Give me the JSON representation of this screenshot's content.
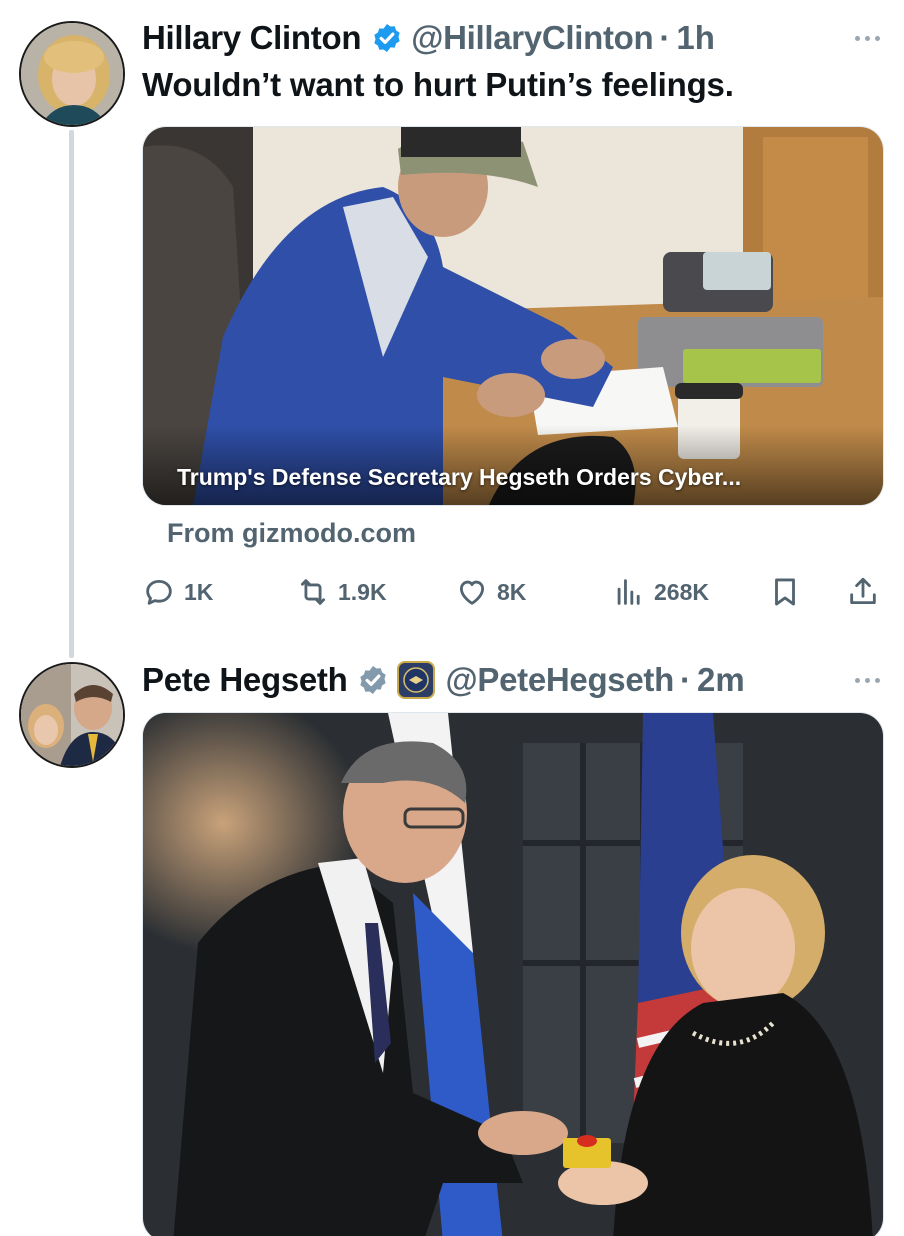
{
  "tweet1": {
    "author_name": "Hillary Clinton",
    "handle": "@HillaryClinton",
    "separator": "·",
    "time": "1h",
    "text": "Wouldn’t want to hurt Putin’s feelings.",
    "link_card": {
      "title": "Trump's Defense Secretary Hegseth Orders Cyber...",
      "source": "From gizmodo.com"
    },
    "stats": {
      "replies": "1K",
      "reposts": "1.9K",
      "likes": "8K",
      "views": "268K"
    }
  },
  "tweet2": {
    "author_name": "Pete Hegseth",
    "handle": "@PeteHegseth",
    "separator": "·",
    "time": "2m"
  },
  "icons": [
    "verified-badge-icon",
    "more-icon",
    "reply-icon",
    "repost-icon",
    "like-icon",
    "views-icon",
    "bookmark-icon",
    "share-icon",
    "dod-seal-icon"
  ],
  "colors": {
    "verified": "#1d9bf0",
    "secondary_text": "#536471",
    "thread_line": "#cfd9de"
  }
}
